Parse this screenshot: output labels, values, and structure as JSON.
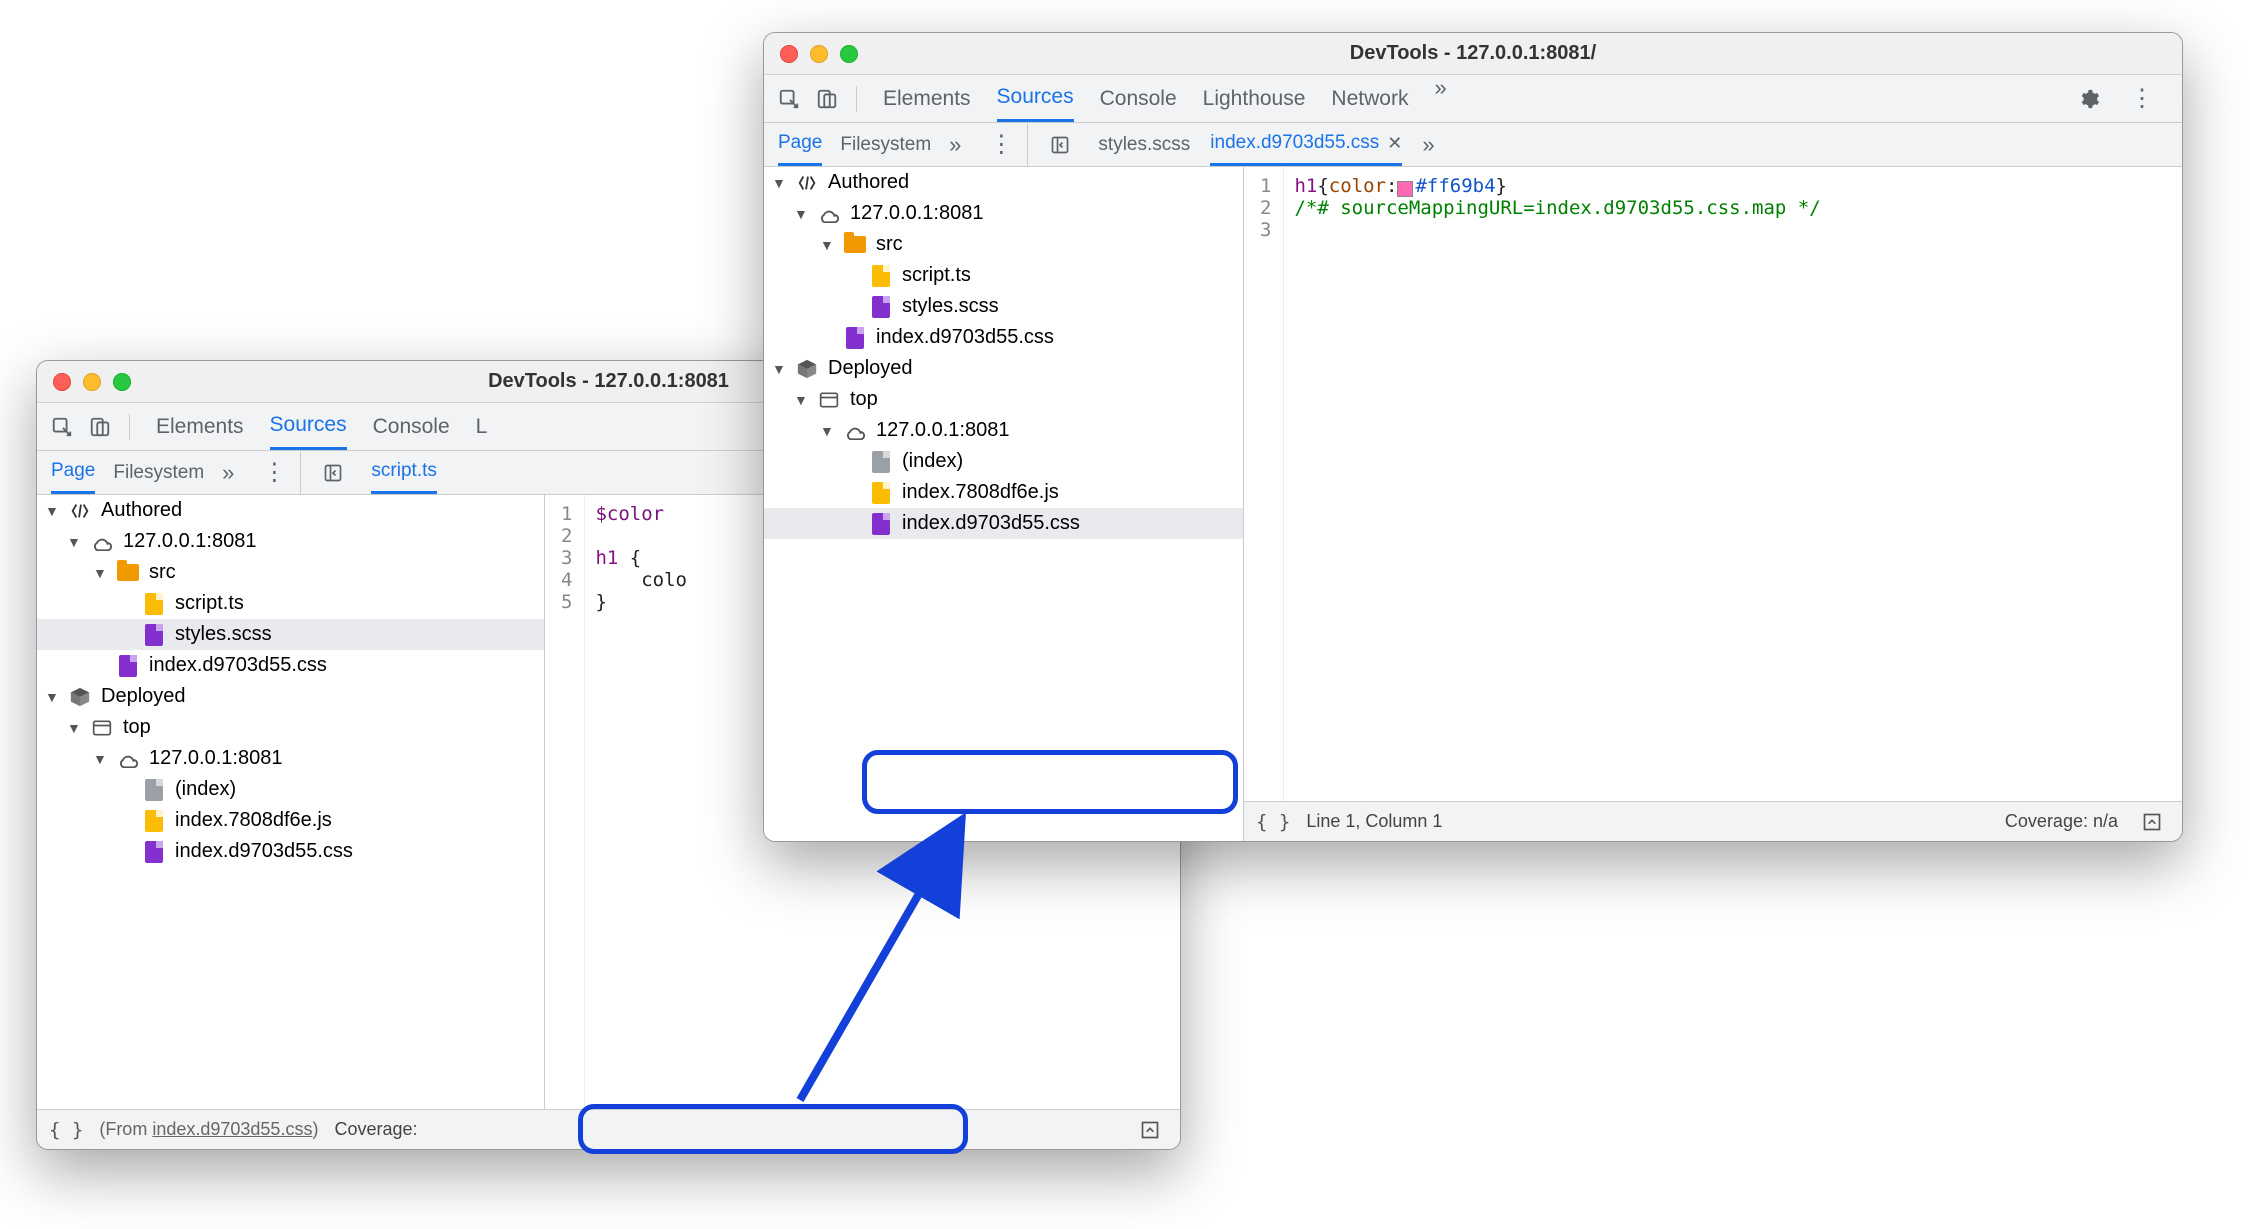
{
  "windowA": {
    "title": "DevTools - 127.0.0.1:8081",
    "tabs": [
      "Elements",
      "Sources",
      "Console",
      "L"
    ],
    "activeTab": "Sources",
    "subTabs": [
      "Page",
      "Filesystem"
    ],
    "activeSubTab": "Page",
    "openFile": "script.ts",
    "tree": {
      "authored": "Authored",
      "host": "127.0.0.1:8081",
      "src": "src",
      "script": "script.ts",
      "styles": "styles.scss",
      "indexcss": "index.d9703d55.css",
      "deployed": "Deployed",
      "top": "top",
      "host2": "127.0.0.1:8081",
      "index": "(index)",
      "indexjs": "index.7808df6e.js",
      "indexcss2": "index.d9703d55.css"
    },
    "code": {
      "line1": "$color",
      "line3a": "h1",
      "line3b": " {",
      "line4": "    colo",
      "line5": "}"
    },
    "status": {
      "from": "(From ",
      "fromFile": "index.d9703d55.css",
      "fromEnd": ")",
      "cov": "Coverage:"
    }
  },
  "windowB": {
    "title": "DevTools - 127.0.0.1:8081/",
    "tabs": [
      "Elements",
      "Sources",
      "Console",
      "Lighthouse",
      "Network"
    ],
    "activeTab": "Sources",
    "subTabs": [
      "Page",
      "Filesystem"
    ],
    "activeSubTab": "Page",
    "fileTabs": [
      "styles.scss",
      "index.d9703d55.css"
    ],
    "activeFile": "index.d9703d55.css",
    "tree": {
      "authored": "Authored",
      "host": "127.0.0.1:8081",
      "src": "src",
      "script": "script.ts",
      "styles": "styles.scss",
      "indexcss": "index.d9703d55.css",
      "deployed": "Deployed",
      "top": "top",
      "host2": "127.0.0.1:8081",
      "index": "(index)",
      "indexjs": "index.7808df6e.js",
      "indexcss2": "index.d9703d55.css"
    },
    "code": {
      "l1_sel": "h1",
      "l1_open": "{",
      "l1_prop": "color",
      "l1_colon": ":",
      "l1_hex": "#ff69b4",
      "l1_close": "}",
      "l2": "/*# sourceMappingURL=index.d9703d55.css.map */"
    },
    "status": {
      "pos": "Line 1, Column 1",
      "cov": "Coverage: n/a"
    }
  }
}
